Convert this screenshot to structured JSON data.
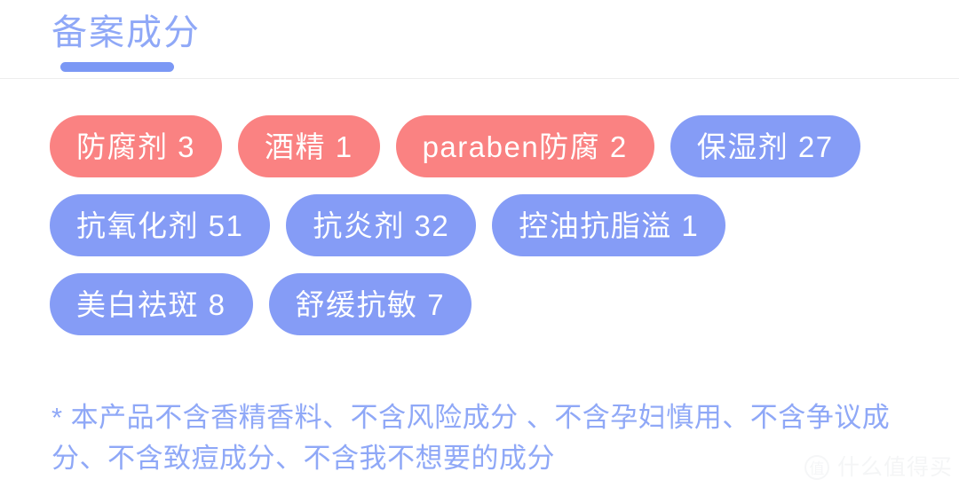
{
  "header": {
    "title": "备案成分",
    "underline_color": "#7B98F5",
    "title_color": "#8FA8F7"
  },
  "tags": {
    "risk_color": "#FA8282",
    "benefit_color": "#859CF6",
    "items": [
      {
        "label": "防腐剂 3",
        "name": "防腐剂",
        "count": 3,
        "type": "risk"
      },
      {
        "label": "酒精 1",
        "name": "酒精",
        "count": 1,
        "type": "risk"
      },
      {
        "label": "paraben防腐 2",
        "name": "paraben防腐",
        "count": 2,
        "type": "risk"
      },
      {
        "label": "保湿剂 27",
        "name": "保湿剂",
        "count": 27,
        "type": "benefit"
      },
      {
        "label": "抗氧化剂 51",
        "name": "抗氧化剂",
        "count": 51,
        "type": "benefit"
      },
      {
        "label": "抗炎剂 32",
        "name": "抗炎剂",
        "count": 32,
        "type": "benefit"
      },
      {
        "label": "控油抗脂溢 1",
        "name": "控油抗脂溢",
        "count": 1,
        "type": "benefit"
      },
      {
        "label": "美白祛斑 8",
        "name": "美白祛斑",
        "count": 8,
        "type": "benefit"
      },
      {
        "label": "舒缓抗敏 7",
        "name": "舒缓抗敏",
        "count": 7,
        "type": "benefit"
      }
    ]
  },
  "footnote": {
    "text": "* 本产品不含香精香料、不含风险成分 、不含孕妇慎用、不含争议成分、不含致痘成分、不含我不想要的成分",
    "color": "#8FA8F7"
  },
  "watermark": {
    "badge": "值",
    "text": "什么值得买"
  }
}
